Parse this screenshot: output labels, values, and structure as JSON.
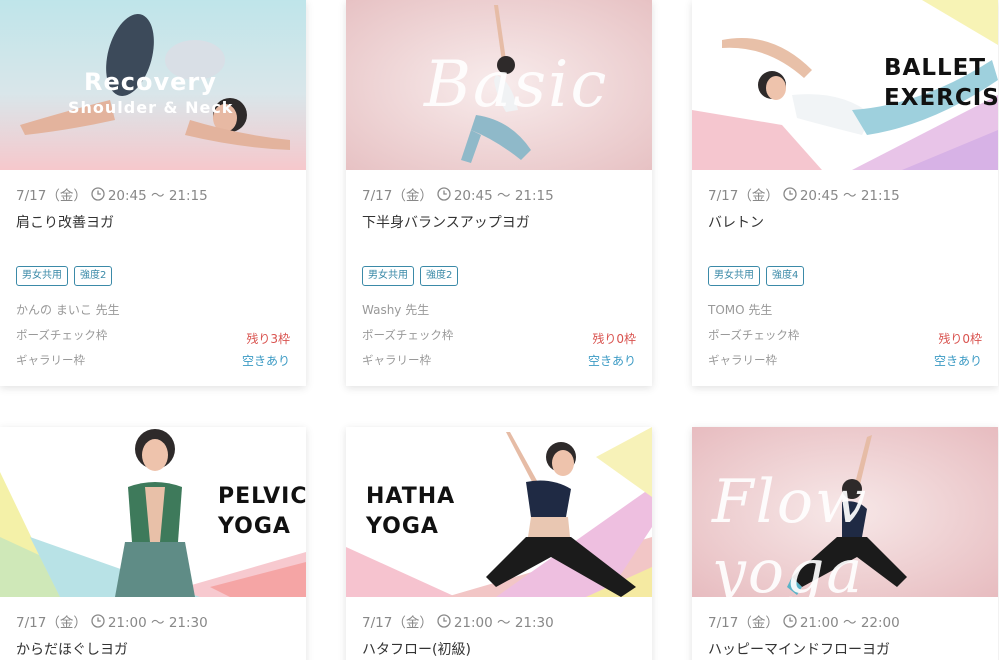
{
  "colors": {
    "accent_tag": "#3b8aa8",
    "remaining_red": "#d9534f",
    "available_blue": "#3b9ac4"
  },
  "cards": [
    {
      "thumb_line1": "Recovery",
      "thumb_line2": "Shoulder & Neck",
      "date": "7/17（金）",
      "time": "20:45 〜 21:15",
      "title": "肩こり改善ヨガ",
      "tags": [
        "男女共用",
        "強度2"
      ],
      "teacher": "かんの まいこ 先生",
      "pose_label": "ポーズチェック枠",
      "pose_value": "残り3枠",
      "gallery_label": "ギャラリー枠",
      "gallery_value": "空きあり"
    },
    {
      "thumb_script": "Basic",
      "date": "7/17（金）",
      "time": "20:45 〜 21:15",
      "title": "下半身バランスアップヨガ",
      "tags": [
        "男女共用",
        "強度2"
      ],
      "teacher": "Washy 先生",
      "pose_label": "ポーズチェック枠",
      "pose_value": "残り0枠",
      "gallery_label": "ギャラリー枠",
      "gallery_value": "空きあり"
    },
    {
      "thumb_line1": "BALLET",
      "thumb_line2": "EXERCISE",
      "date": "7/17（金）",
      "time": "20:45 〜 21:15",
      "title": "バレトン",
      "tags": [
        "男女共用",
        "強度4"
      ],
      "teacher": "TOMO 先生",
      "pose_label": "ポーズチェック枠",
      "pose_value": "残り0枠",
      "gallery_label": "ギャラリー枠",
      "gallery_value": "空きあり"
    },
    {
      "thumb_line1": "PELVIC",
      "thumb_line2": "YOGA",
      "date": "7/17（金）",
      "time": "21:00 〜 21:30",
      "title": "からだほぐしヨガ"
    },
    {
      "thumb_line1": "HATHA",
      "thumb_line2": "YOGA",
      "date": "7/17（金）",
      "time": "21:00 〜 21:30",
      "title": "ハタフロー(初級)"
    },
    {
      "thumb_script": "Flow yoga",
      "date": "7/17（金）",
      "time": "21:00 〜 22:00",
      "title": "ハッピーマインドフローヨガ"
    }
  ]
}
